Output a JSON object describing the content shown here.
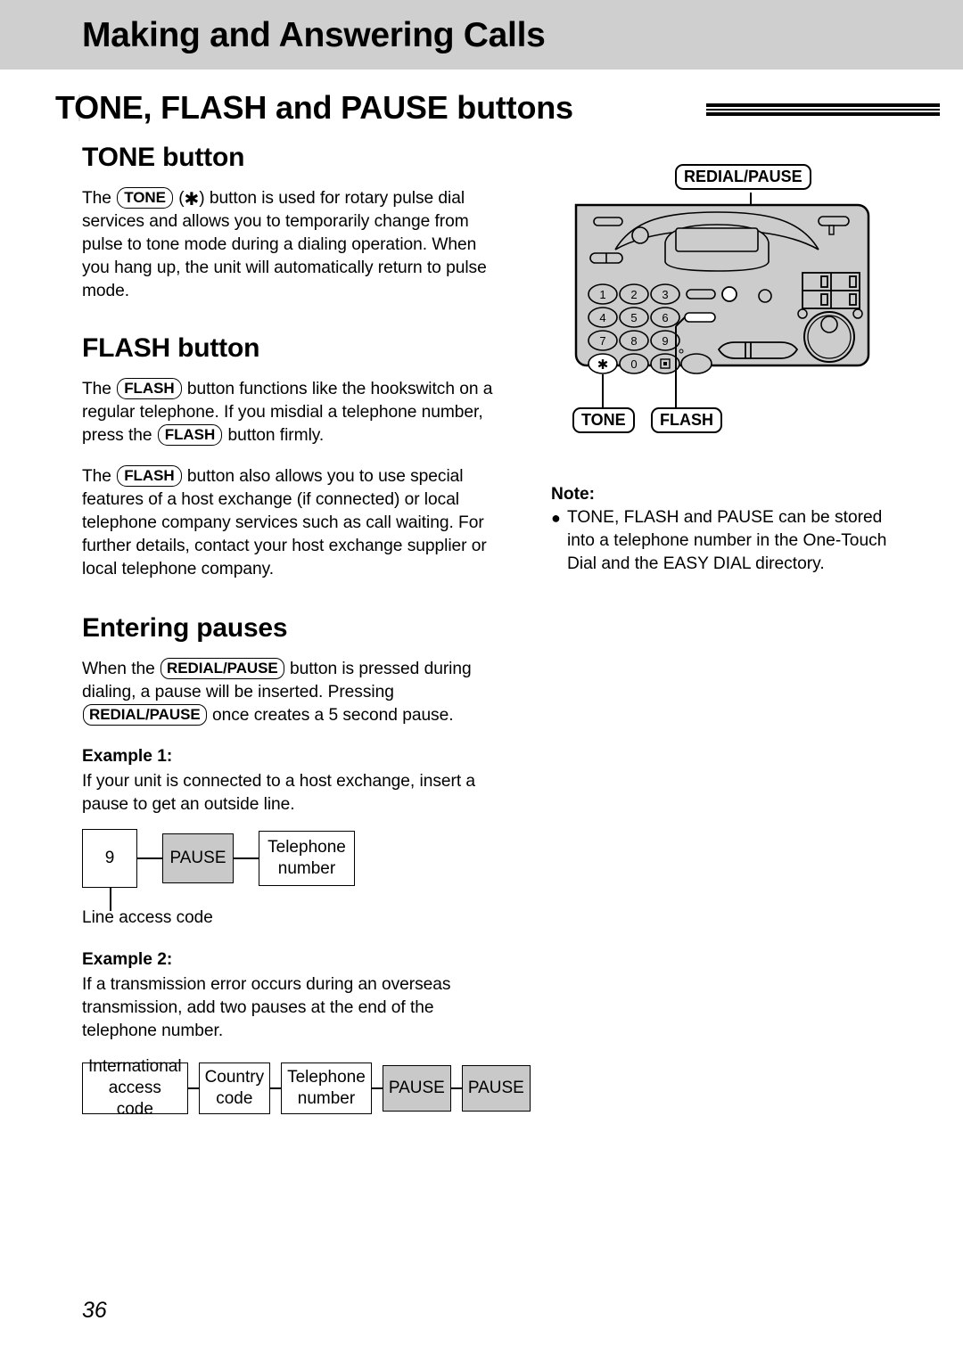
{
  "header": {
    "running_title": "Making and Answering Calls"
  },
  "chapter": {
    "title": "TONE, FLASH and PAUSE buttons"
  },
  "sections": {
    "tone": {
      "heading": "TONE button",
      "paragraph_pre": "The",
      "key": "TONE",
      "paren_open": "(",
      "star": "✱",
      "paren_close": ")",
      "paragraph_post": "button is used for rotary pulse dial services and allows you to temporarily change from pulse to tone mode during a dialing operation. When you hang up, the unit will automatically return to pulse mode."
    },
    "flash": {
      "heading": "FLASH button",
      "p1_a": "The",
      "p1_key1": "FLASH",
      "p1_b": "button functions like the hookswitch on a regular telephone. If you misdial a telephone number, press the",
      "p1_key2": "FLASH",
      "p1_c": "button firmly.",
      "p2_a": "The",
      "p2_key": "FLASH",
      "p2_b": "button also allows you to use special features of a host exchange (if connected) or local telephone company services such as call waiting. For further details, contact your host exchange supplier or local telephone company."
    },
    "pauses": {
      "heading": "Entering pauses",
      "p_a": "When the",
      "p_key1": "REDIAL/PAUSE",
      "p_b": "button is pressed during dialing, a pause will be inserted. Pressing",
      "p_key2": "REDIAL/PAUSE",
      "p_c": "once creates a 5 second pause."
    }
  },
  "example1": {
    "label": "Example 1:",
    "text": "If your unit is connected to a host exchange, insert a pause to get an outside line.",
    "boxes": [
      {
        "text": "9",
        "shaded": false
      },
      {
        "text": "PAUSE",
        "shaded": true
      },
      {
        "text": "Telephone\nnumber",
        "shaded": false
      }
    ],
    "leader_label": "Line access code"
  },
  "example2": {
    "label": "Example 2:",
    "text": "If a transmission error occurs during an overseas transmission, add two pauses at the end of the telephone number.",
    "boxes": [
      {
        "text": "International\naccess code",
        "shaded": false
      },
      {
        "text": "Country\ncode",
        "shaded": false
      },
      {
        "text": "Telephone\nnumber",
        "shaded": false
      },
      {
        "text": "PAUSE",
        "shaded": true
      },
      {
        "text": "PAUSE",
        "shaded": true
      }
    ]
  },
  "device": {
    "callout_top": "REDIAL/PAUSE",
    "callout_tone": "TONE",
    "callout_flash": "FLASH",
    "keypad": [
      "1",
      "2",
      "3",
      "4",
      "5",
      "6",
      "7",
      "8",
      "9",
      "✱",
      "0",
      "■"
    ]
  },
  "note": {
    "title": "Note:",
    "bullet": "●",
    "text": "TONE, FLASH and PAUSE can be stored into a telephone number in the One-Touch Dial and the EASY DIAL directory."
  },
  "folio": {
    "page_number": "36"
  },
  "colors": {
    "header_band": "#cfcfcf",
    "shaded_box": "#c9c9c9",
    "device_body": "#cccccc",
    "ink": "#000000"
  }
}
